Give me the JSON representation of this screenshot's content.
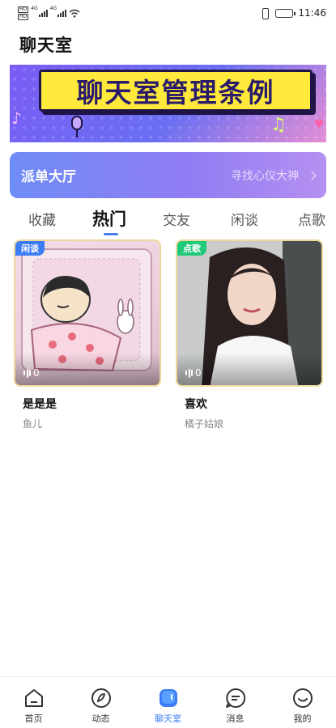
{
  "status_bar": {
    "sim1": "HD",
    "sim2": "HD",
    "net1": "4G",
    "net2": "4G",
    "battery": "",
    "time": "11:46"
  },
  "header": {
    "title": "聊天室"
  },
  "banner": {
    "text": "聊天室管理条例"
  },
  "dispatch": {
    "title": "派单大厅",
    "subtitle": "寻找心仪大神"
  },
  "tabs": [
    {
      "label": "收藏",
      "active": false
    },
    {
      "label": "热门",
      "active": true
    },
    {
      "label": "交友",
      "active": false
    },
    {
      "label": "闲谈",
      "active": false
    },
    {
      "label": "点歌",
      "active": false
    }
  ],
  "rooms": [
    {
      "tag": "闲谈",
      "count": "0",
      "title": "是是是",
      "owner": "鱼儿"
    },
    {
      "tag": "点歌",
      "count": "0",
      "title": "喜欢",
      "owner": "橘子姑娘"
    }
  ],
  "bottom_nav": [
    {
      "label": "首页",
      "icon": "home-icon",
      "active": false
    },
    {
      "label": "动态",
      "icon": "feed-icon",
      "active": false
    },
    {
      "label": "聊天室",
      "icon": "chatroom-icon",
      "active": true
    },
    {
      "label": "消息",
      "icon": "message-icon",
      "active": false
    },
    {
      "label": "我的",
      "icon": "profile-icon",
      "active": false
    }
  ],
  "colors": {
    "accent": "#3b7cf5",
    "tag_blue": "#3b7cf5",
    "tag_green": "#1fc97a",
    "banner_plate": "#ffe93b"
  }
}
